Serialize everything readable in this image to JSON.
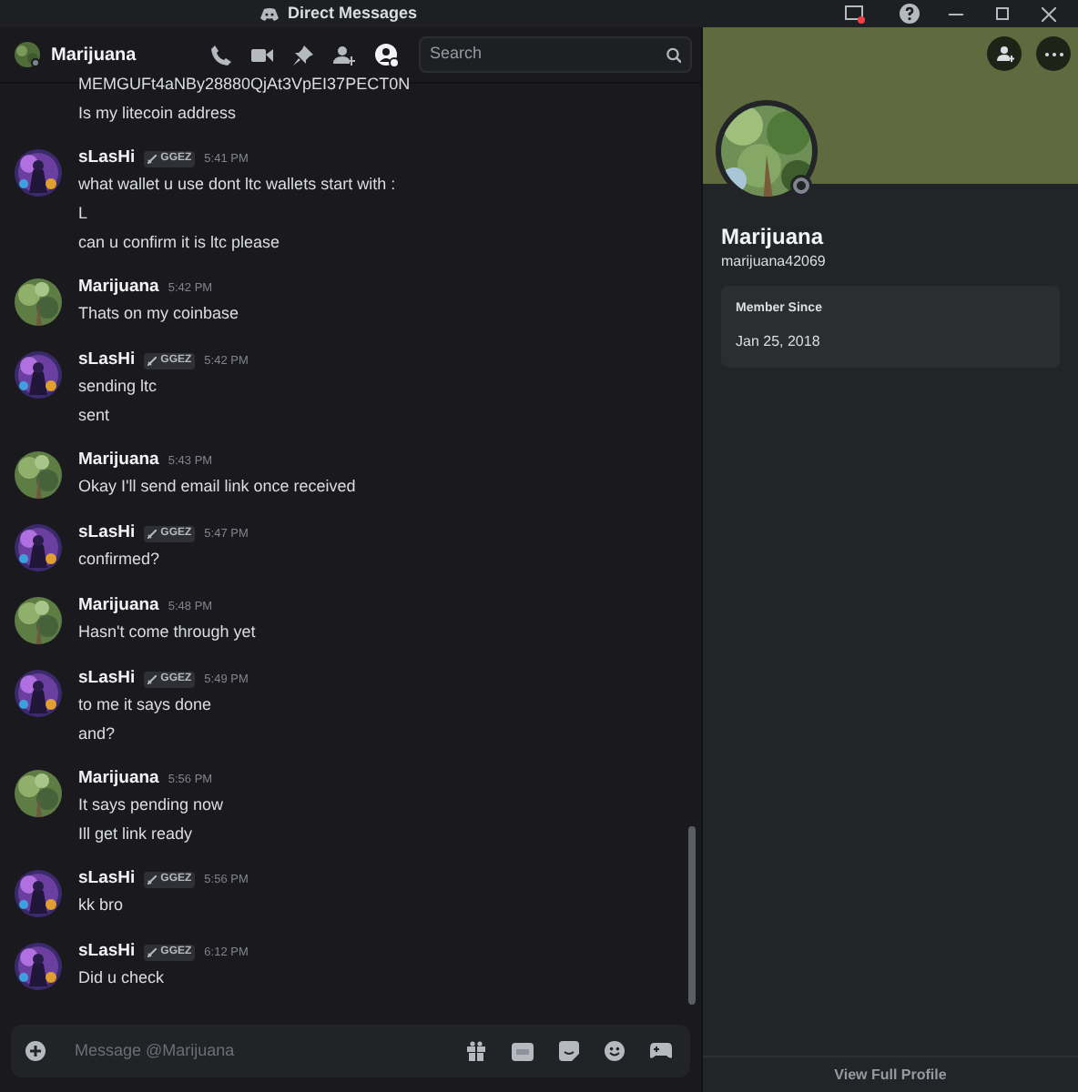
{
  "window": {
    "title": "Direct Messages"
  },
  "header": {
    "name": "Marijuana",
    "search": {
      "placeholder": "Search"
    }
  },
  "messages": [
    {
      "kind": "continued",
      "lines": [
        "MEMGUFt4aNBy28880QjAt3VpEI37PECT0N",
        "Is my litecoin address"
      ]
    },
    {
      "kind": "sender",
      "author": "sLasHi",
      "badge": "GGEZ",
      "time": "5:41 PM",
      "lines": [
        "what wallet u use dont ltc wallets start with :",
        "L",
        "can u confirm it is ltc please"
      ]
    },
    {
      "kind": "recipient",
      "author": "Marijuana",
      "time": "5:42 PM",
      "lines": [
        "Thats on my coinbase"
      ]
    },
    {
      "kind": "sender",
      "author": "sLasHi",
      "badge": "GGEZ",
      "time": "5:42 PM",
      "lines": [
        "sending ltc",
        "sent"
      ]
    },
    {
      "kind": "recipient",
      "author": "Marijuana",
      "time": "5:43 PM",
      "lines": [
        "Okay I'll send email link once received"
      ]
    },
    {
      "kind": "sender",
      "author": "sLasHi",
      "badge": "GGEZ",
      "time": "5:47 PM",
      "lines": [
        "confirmed?"
      ]
    },
    {
      "kind": "recipient",
      "author": "Marijuana",
      "time": "5:48 PM",
      "lines": [
        "Hasn't come through yet"
      ]
    },
    {
      "kind": "sender",
      "author": "sLasHi",
      "badge": "GGEZ",
      "time": "5:49 PM",
      "lines": [
        "to me it says done",
        "and?"
      ]
    },
    {
      "kind": "recipient",
      "author": "Marijuana",
      "time": "5:56 PM",
      "lines": [
        "It says pending now",
        "Ill get link ready"
      ]
    },
    {
      "kind": "sender",
      "author": "sLasHi",
      "badge": "GGEZ",
      "time": "5:56 PM",
      "lines": [
        "kk bro"
      ]
    },
    {
      "kind": "sender",
      "author": "sLasHi",
      "badge": "GGEZ",
      "time": "6:12 PM",
      "lines": [
        "Did u check"
      ]
    }
  ],
  "composer": {
    "placeholder": "Message @Marijuana"
  },
  "profile": {
    "display_name": "Marijuana",
    "username": "marijuana42069",
    "member_since": {
      "label": "Member Since",
      "date": "Jan 25, 2018"
    },
    "footer_link": "View Full Profile"
  }
}
